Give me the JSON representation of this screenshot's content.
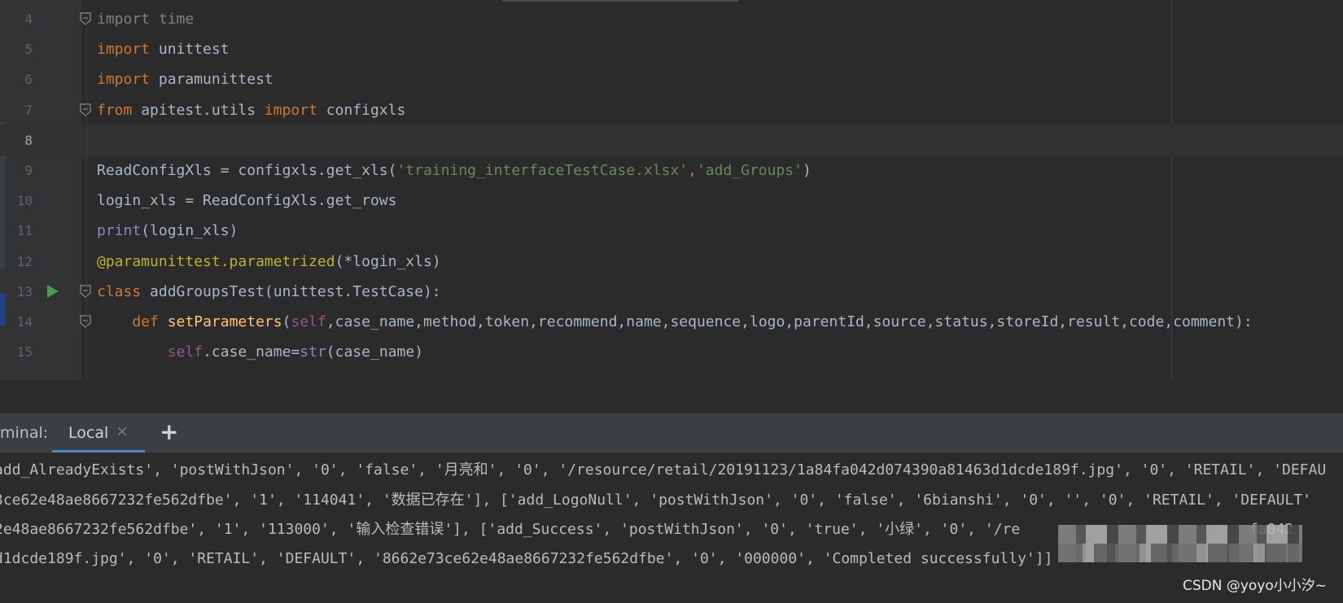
{
  "editor": {
    "lines": [
      {
        "num": "4",
        "fold": true,
        "tokens": [
          {
            "t": "import time",
            "c": "faded"
          }
        ]
      },
      {
        "num": "5",
        "tokens": [
          {
            "t": "import",
            "c": "kw"
          },
          {
            "t": " unittest",
            "c": ""
          }
        ]
      },
      {
        "num": "6",
        "tokens": [
          {
            "t": "import",
            "c": "kw"
          },
          {
            "t": " paramunittest",
            "c": ""
          }
        ]
      },
      {
        "num": "7",
        "fold": true,
        "tokens": [
          {
            "t": "from",
            "c": "kw"
          },
          {
            "t": " apitest.utils ",
            "c": ""
          },
          {
            "t": "import",
            "c": "kw"
          },
          {
            "t": " configxls",
            "c": ""
          }
        ]
      },
      {
        "num": "8",
        "current": true,
        "tokens": []
      },
      {
        "num": "9",
        "tokens": [
          {
            "t": "ReadConfigXls = configxls.get_xls(",
            "c": ""
          },
          {
            "t": "'training_interfaceTestCase.xlsx'",
            "c": "str"
          },
          {
            "t": ",",
            "c": "kw"
          },
          {
            "t": "'add_Groups'",
            "c": "str"
          },
          {
            "t": ")",
            "c": ""
          }
        ]
      },
      {
        "num": "10",
        "tokens": [
          {
            "t": "login_xls = ReadConfigXls.get_rows",
            "c": ""
          }
        ]
      },
      {
        "num": "11",
        "tokens": [
          {
            "t": "print",
            "c": "builtin"
          },
          {
            "t": "(login_xls)",
            "c": ""
          }
        ]
      },
      {
        "num": "12",
        "tokens": [
          {
            "t": "@paramunittest.parametrized",
            "c": "deco"
          },
          {
            "t": "(*login_xls)",
            "c": ""
          }
        ]
      },
      {
        "num": "13",
        "run": true,
        "fold": true,
        "tokens": [
          {
            "t": "class",
            "c": "kw"
          },
          {
            "t": " addGroupsTest(unittest.TestCase):",
            "c": ""
          }
        ]
      },
      {
        "num": "14",
        "fold": true,
        "tokens": [
          {
            "t": "    ",
            "c": ""
          },
          {
            "t": "def",
            "c": "kw"
          },
          {
            "t": " ",
            "c": ""
          },
          {
            "t": "setParameters",
            "c": "fn"
          },
          {
            "t": "(",
            "c": ""
          },
          {
            "t": "self",
            "c": "self"
          },
          {
            "t": ",case_name,method,token,recommend,name,sequence,logo,parentId,source,status,storeId,result,code,comment):",
            "c": ""
          }
        ]
      },
      {
        "num": "15",
        "tokens": [
          {
            "t": "        ",
            "c": ""
          },
          {
            "t": "self",
            "c": "self"
          },
          {
            "t": ".case_name=",
            "c": ""
          },
          {
            "t": "str",
            "c": "builtin"
          },
          {
            "t": "(case_name)",
            "c": ""
          }
        ]
      }
    ]
  },
  "terminal": {
    "title": "minal:",
    "tab_label": "Local",
    "close_glyph": "×",
    "add_glyph": "+",
    "output": [
      "add_AlreadyExists', 'postWithJson', '0', 'false', '月亮和', '0', '/resource/retail/20191123/1a84fa042d074390a81463d1dcde189f.jpg', '0', 'RETAIL', 'DEFAU",
      "3ce62e48ae8667232fe562dfbe', '1', '114041', '数据已存在'], ['add_LogoNull', 'postWithJson', '0', 'false', '6bianshi', '0', '', '0', 'RETAIL', 'DEFAULT'",
      "2e48ae8667232fe562dfbe', '1', '113000', '输入检查错误'], ['add_Success', 'postWithJson', '0', 'true', '小绿', '0', '/re                          fa042",
      "d1dcde189f.jpg', '0', 'RETAIL', 'DEFAULT', '8662e73ce62e48ae8667232fe562dfbe', '0', '000000', 'Completed successfully']]"
    ]
  },
  "watermark": "CSDN @yoyo小小汐~"
}
